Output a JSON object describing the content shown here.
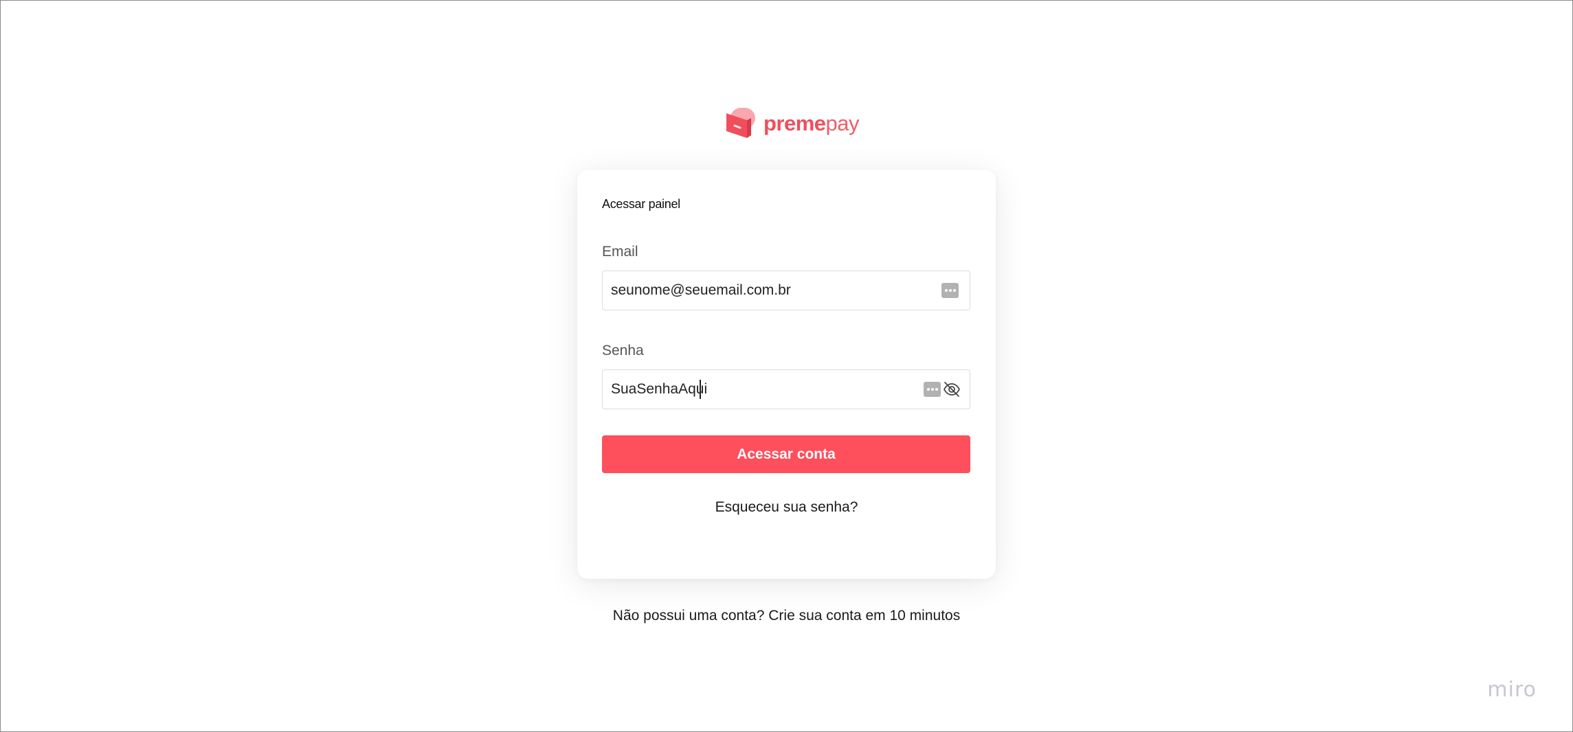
{
  "brand": {
    "name_bold": "preme",
    "name_light": "pay",
    "color": "#f04e5c"
  },
  "card": {
    "title": "Acessar painel"
  },
  "email": {
    "label": "Email",
    "value": "seunome@seuemail.com.br",
    "icon": "kebab-icon"
  },
  "password": {
    "label": "Senha",
    "value": "SuaSenhaAqui",
    "icons": [
      "kebab-icon",
      "eye-slash-icon"
    ]
  },
  "submit": {
    "label": "Acessar conta",
    "color": "#fd4f5c"
  },
  "forgot": {
    "label": "Esqueceu sua senha?"
  },
  "signup": {
    "prefix": "Não possui uma conta? ",
    "link": "Crie sua conta em 10 minutos"
  },
  "watermark": {
    "text": "miro"
  }
}
